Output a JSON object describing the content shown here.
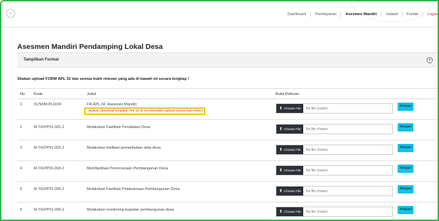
{
  "nav": {
    "items": [
      "Dashboard",
      "Pembayaran",
      "Asesmen Mandiri",
      "Jadwal",
      "Kontak",
      "Logout"
    ]
  },
  "page": {
    "title": "Asesmen Mandiri Pendamping Lokal Desa",
    "format_label": "Tampilkan Format",
    "instruction": "Silakan upload FORM APL 02 dan semua bukti relevan yang ada di bawah ini secara lengkap !"
  },
  "table": {
    "headers": {
      "no": "No",
      "kode": "Kode",
      "judul": "Judul",
      "bukti": "Bukti Relevan"
    },
    "rows": [
      {
        "no": "1",
        "kode": "01/SKM-PLD/24",
        "judul": "FR.APL.02. Asesmen Mandiri",
        "note": "Silakan download template APL 02 di sini kemudian upload sesuai isian kolom"
      },
      {
        "no": "2",
        "kode": "M.741PP01.001.2",
        "judul": "Melakukan Fasilitasi Pendataan Desa"
      },
      {
        "no": "3",
        "kode": "M.741PP01.002.2",
        "judul": "Melakukan fasilitasi pemanfaatan data desa"
      },
      {
        "no": "4",
        "kode": "M.741PP01.004.2",
        "judul": "Memfasilitasi Perencanaan Pembangunan Desa"
      },
      {
        "no": "5",
        "kode": "M.741PP01.005.2",
        "judul": "Melakukan Fasilitasi Pelaksanaan Pembangunan Desa"
      },
      {
        "no": "6",
        "kode": "M.741PP01.006.2",
        "judul": "Melakukan monitoring kegiatan pembangunan desa"
      }
    ]
  },
  "file": {
    "choose_label": "Choose File",
    "no_file": "No file chosen"
  },
  "save_label": "Simpan",
  "colors": {
    "accent": "#15c1e6",
    "frame": "#2fb84a",
    "warning_border": "#f2c21b",
    "warning_text": "#d9261c"
  }
}
